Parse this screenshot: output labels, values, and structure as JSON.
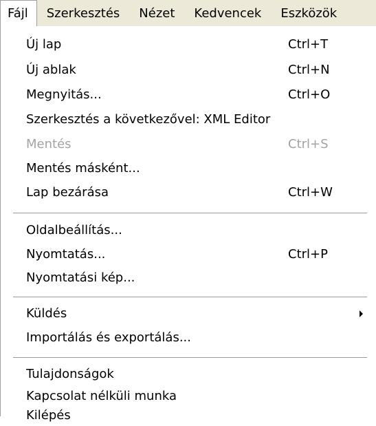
{
  "menubar": {
    "items": [
      {
        "label": "Fájl"
      },
      {
        "label": "Szerkesztés"
      },
      {
        "label": "Nézet"
      },
      {
        "label": "Kedvencek"
      },
      {
        "label": "Eszközök"
      }
    ]
  },
  "file_menu": {
    "items": [
      {
        "label": "Új lap",
        "shortcut": "Ctrl+T"
      },
      {
        "label": "Új ablak",
        "shortcut": "Ctrl+N"
      },
      {
        "label": "Megnyitás...",
        "shortcut": "Ctrl+O"
      },
      {
        "label": "Szerkesztés a következővel: XML Editor",
        "shortcut": ""
      },
      {
        "label": "Mentés",
        "shortcut": "Ctrl+S",
        "disabled": true
      },
      {
        "label": "Mentés másként...",
        "shortcut": ""
      },
      {
        "label": "Lap bezárása",
        "shortcut": "Ctrl+W"
      },
      {
        "label": "Oldalbeállítás...",
        "shortcut": ""
      },
      {
        "label": "Nyomtatás...",
        "shortcut": "Ctrl+P"
      },
      {
        "label": "Nyomtatási kép...",
        "shortcut": ""
      },
      {
        "label": "Küldés",
        "shortcut": "",
        "submenu": true
      },
      {
        "label": "Importálás és exportálás...",
        "shortcut": ""
      },
      {
        "label": "Tulajdonságok",
        "shortcut": ""
      },
      {
        "label": "Kapcsolat nélküli munka",
        "shortcut": ""
      },
      {
        "label": "Kilépés",
        "shortcut": ""
      }
    ]
  },
  "colors": {
    "menubar_bg": "#ece9d8",
    "disabled_text": "#a3a3a3",
    "separator": "#9a9a9a"
  }
}
